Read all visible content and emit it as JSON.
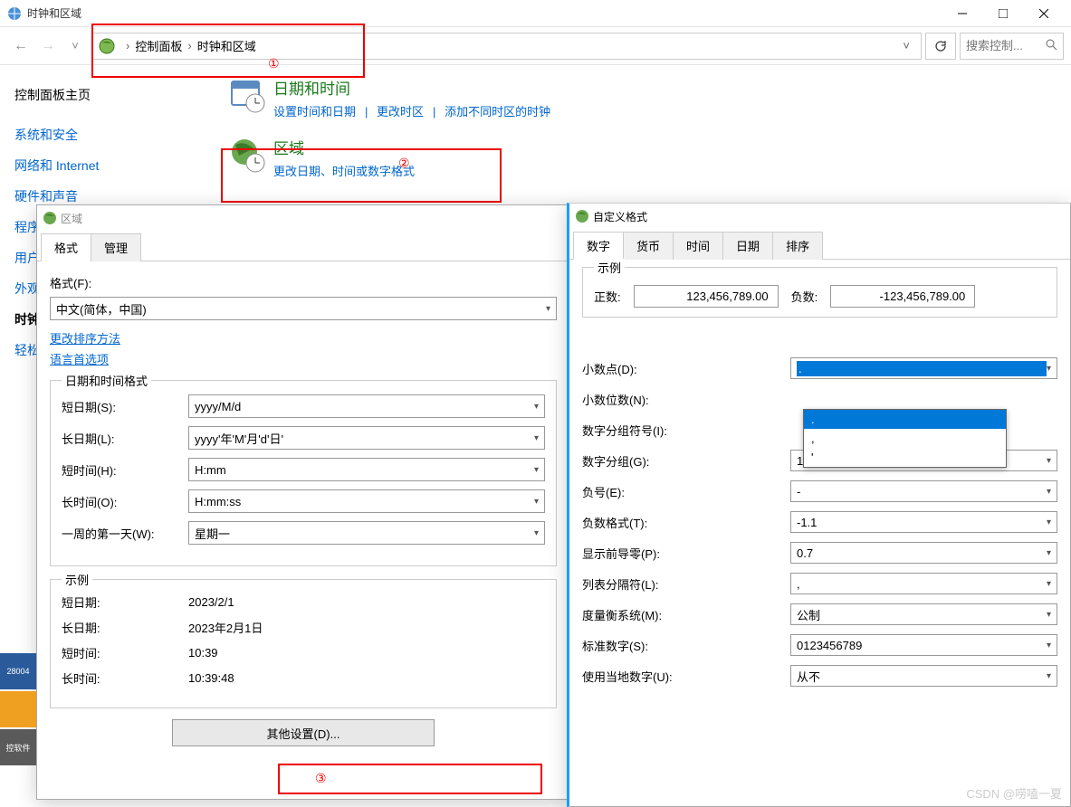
{
  "window": {
    "title": "时钟和区域"
  },
  "toolbar": {
    "breadcrumb": [
      "控制面板",
      "时钟和区域"
    ],
    "search_placeholder": "搜索控制..."
  },
  "sidebar": {
    "head": "控制面板主页",
    "items": [
      "系统和安全",
      "网络和 Internet",
      "硬件和声音",
      "程序",
      "用户",
      "外观",
      "时钟",
      "轻松"
    ]
  },
  "categories": [
    {
      "title": "日期和时间",
      "links": [
        "设置时间和日期",
        "更改时区",
        "添加不同时区的时钟"
      ]
    },
    {
      "title": "区域",
      "links": [
        "更改日期、时间或数字格式"
      ]
    }
  ],
  "region_dialog": {
    "title": "区域",
    "tabs": [
      "格式",
      "管理"
    ],
    "format_label": "格式(F):",
    "format_value": "中文(简体，中国)",
    "link_sort": "更改排序方法",
    "link_lang": "语言首选项",
    "dt_fieldset": "日期和时间格式",
    "rows": [
      {
        "label": "短日期(S):",
        "value": "yyyy/M/d"
      },
      {
        "label": "长日期(L):",
        "value": "yyyy'年'M'月'd'日'"
      },
      {
        "label": "短时间(H):",
        "value": "H:mm"
      },
      {
        "label": "长时间(O):",
        "value": "H:mm:ss"
      },
      {
        "label": "一周的第一天(W):",
        "value": "星期一"
      }
    ],
    "ex_fieldset": "示例",
    "examples": [
      {
        "label": "短日期:",
        "value": "2023/2/1"
      },
      {
        "label": "长日期:",
        "value": "2023年2月1日"
      },
      {
        "label": "短时间:",
        "value": "10:39"
      },
      {
        "label": "长时间:",
        "value": "10:39:48"
      }
    ],
    "other_btn": "其他设置(D)..."
  },
  "custom_dialog": {
    "title": "自定义格式",
    "tabs": [
      "数字",
      "货币",
      "时间",
      "日期",
      "排序"
    ],
    "example_title": "示例",
    "pos_label": "正数:",
    "pos_value": "123,456,789.00",
    "neg_label": "负数:",
    "neg_value": "-123,456,789.00",
    "rows": [
      {
        "label": "小数点(D):",
        "value": ".",
        "open": true
      },
      {
        "label": "小数位数(N):",
        "value": ""
      },
      {
        "label": "数字分组符号(I):",
        "value": ""
      },
      {
        "label": "数字分组(G):",
        "value": "123,456,789"
      },
      {
        "label": "负号(E):",
        "value": "-"
      },
      {
        "label": "负数格式(T):",
        "value": "-1.1"
      },
      {
        "label": "显示前导零(P):",
        "value": "0.7"
      },
      {
        "label": "列表分隔符(L):",
        "value": ","
      },
      {
        "label": "度量衡系统(M):",
        "value": "公制"
      },
      {
        "label": "标准数字(S):",
        "value": "0123456789"
      },
      {
        "label": "使用当地数字(U):",
        "value": "从不"
      }
    ],
    "dropdown_items": [
      ".",
      ",",
      "'"
    ]
  },
  "annotations": {
    "n1": "①",
    "n2": "②",
    "n3": "③"
  },
  "taskbar": {
    "item1": "28004",
    "item3": "控软件"
  },
  "watermark": "CSDN @唠嗑一夏"
}
